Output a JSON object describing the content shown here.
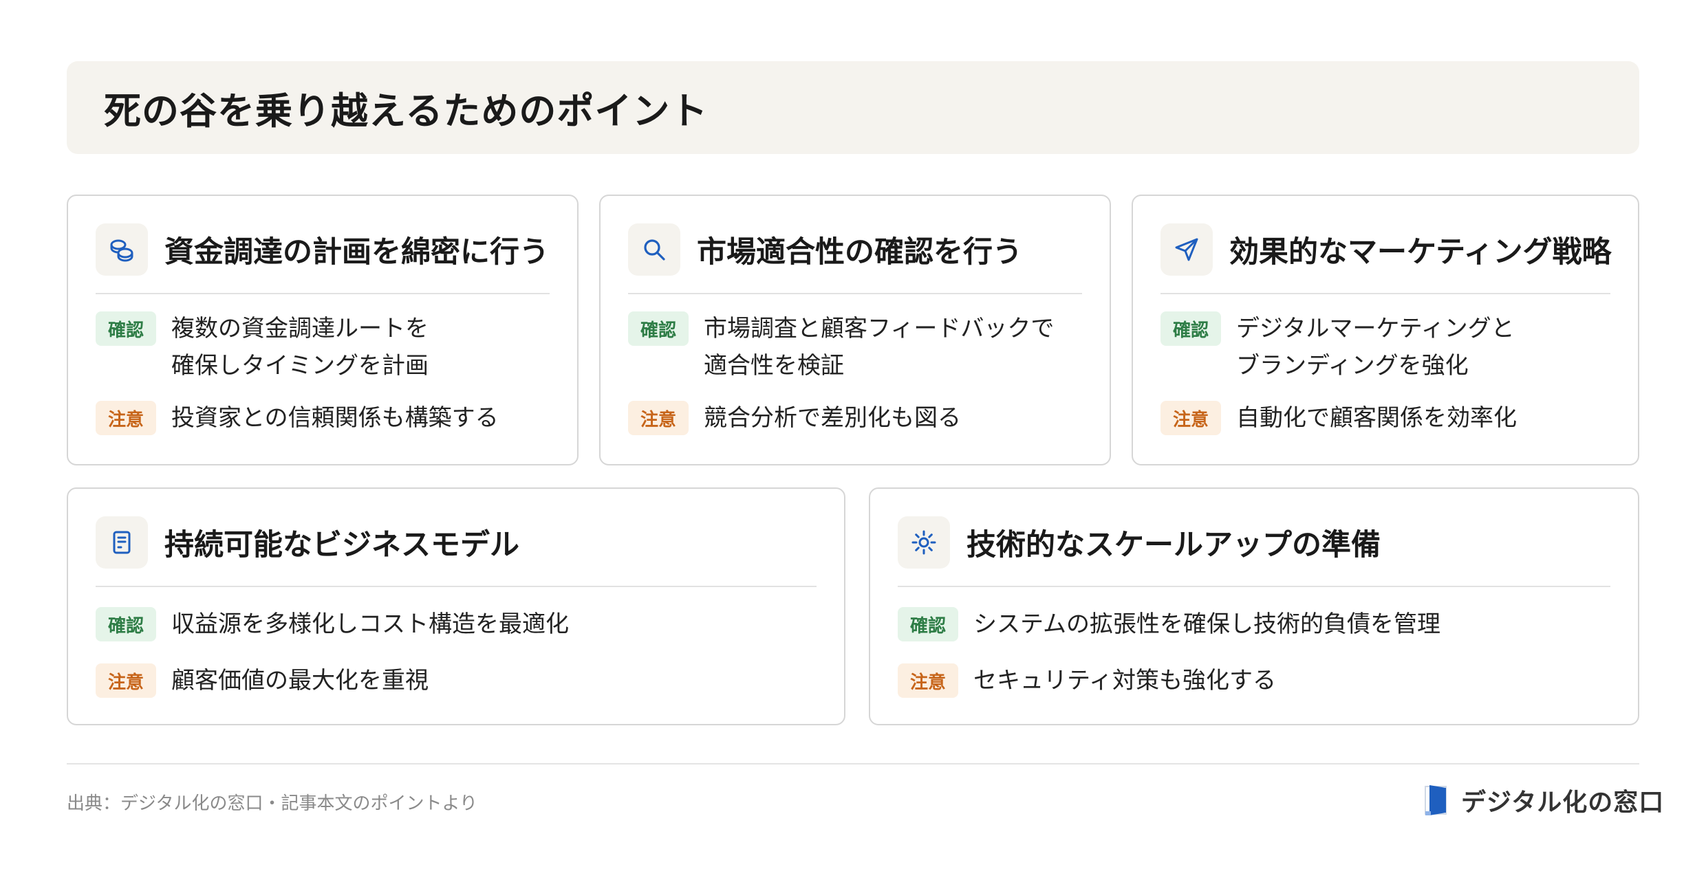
{
  "page_title": "死の谷を乗り越えるためのポイント",
  "cards": [
    {
      "title": "資金調達の計画を綿密に行う",
      "icon": "coins-icon",
      "confirm_label": "確認",
      "confirm_text": "複数の資金調達ルートを\n確保しタイミングを計画",
      "caution_label": "注意",
      "caution_text": "投資家との信頼関係も構築する"
    },
    {
      "title": "市場適合性の確認を行う",
      "icon": "search-icon",
      "confirm_label": "確認",
      "confirm_text": "市場調査と顧客フィードバックで\n適合性を検証",
      "caution_label": "注意",
      "caution_text": "競合分析で差別化も図る"
    },
    {
      "title": "効果的なマーケティング戦略",
      "icon": "send-icon",
      "confirm_label": "確認",
      "confirm_text": "デジタルマーケティングと\nブランディングを強化",
      "caution_label": "注意",
      "caution_text": "自動化で顧客関係を効率化"
    },
    {
      "title": "持続可能なビジネスモデル",
      "icon": "document-icon",
      "confirm_label": "確認",
      "confirm_text": "収益源を多様化しコスト構造を最適化",
      "caution_label": "注意",
      "caution_text": "顧客価値の最大化を重視"
    },
    {
      "title": "技術的なスケールアップの準備",
      "icon": "sun-icon",
      "confirm_label": "確認",
      "confirm_text": "システムの拡張性を確保し技術的負債を管理",
      "caution_label": "注意",
      "caution_text": "セキュリティ対策も強化する"
    }
  ],
  "footer": {
    "source": "出典：デジタル化の窓口・記事本文のポイントより",
    "logo_text": "デジタル化の窓口"
  },
  "colors": {
    "accent": "#1f5fbf",
    "confirm_bg": "#e5f4e9",
    "confirm_fg": "#2e7d46",
    "caution_bg": "#fcefe1",
    "caution_fg": "#c7651a"
  }
}
